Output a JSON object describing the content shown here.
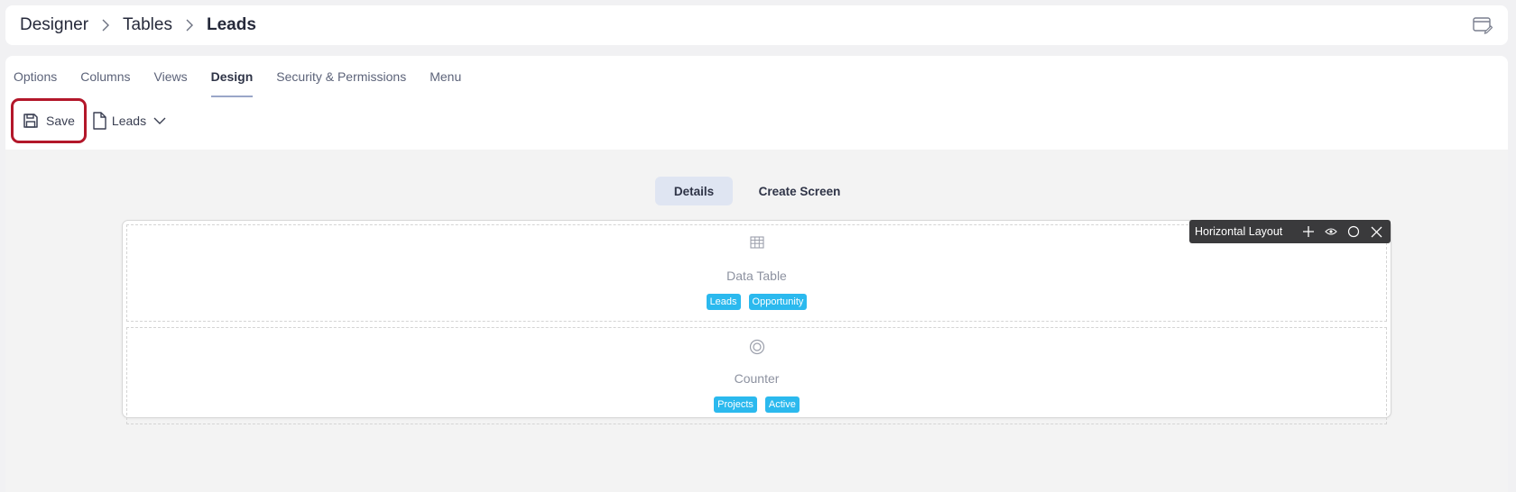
{
  "breadcrumb": {
    "items": [
      "Designer",
      "Tables",
      "Leads"
    ]
  },
  "tabs": [
    {
      "label": "Options"
    },
    {
      "label": "Columns"
    },
    {
      "label": "Views"
    },
    {
      "label": "Design",
      "active": true
    },
    {
      "label": "Security & Permissions"
    },
    {
      "label": "Menu"
    }
  ],
  "toolbar": {
    "save_label": "Save",
    "save_icon": "floppy-disk-icon",
    "doc_label": "Leads",
    "doc_icon": "document-icon"
  },
  "segmented": {
    "details_label": "Details",
    "create_label": "Create Screen",
    "active": "Details"
  },
  "layout_toolbar": {
    "label": "Horizontal Layout",
    "icons": [
      "plus-icon",
      "eye-icon",
      "circle-icon",
      "close-icon"
    ]
  },
  "widgets": [
    {
      "title": "Data Table",
      "icon": "grid-table-icon",
      "tags": [
        "Leads",
        "Opportunity"
      ]
    },
    {
      "title": "Counter",
      "icon": "counter-icon",
      "tags": [
        "Projects",
        "Active"
      ]
    }
  ],
  "colors": {
    "accent_tag": "#2bb9ee",
    "save_highlight": "#b3172a",
    "segment_active": "#dfe5f2",
    "layout_bar": "#3a3a3c"
  }
}
